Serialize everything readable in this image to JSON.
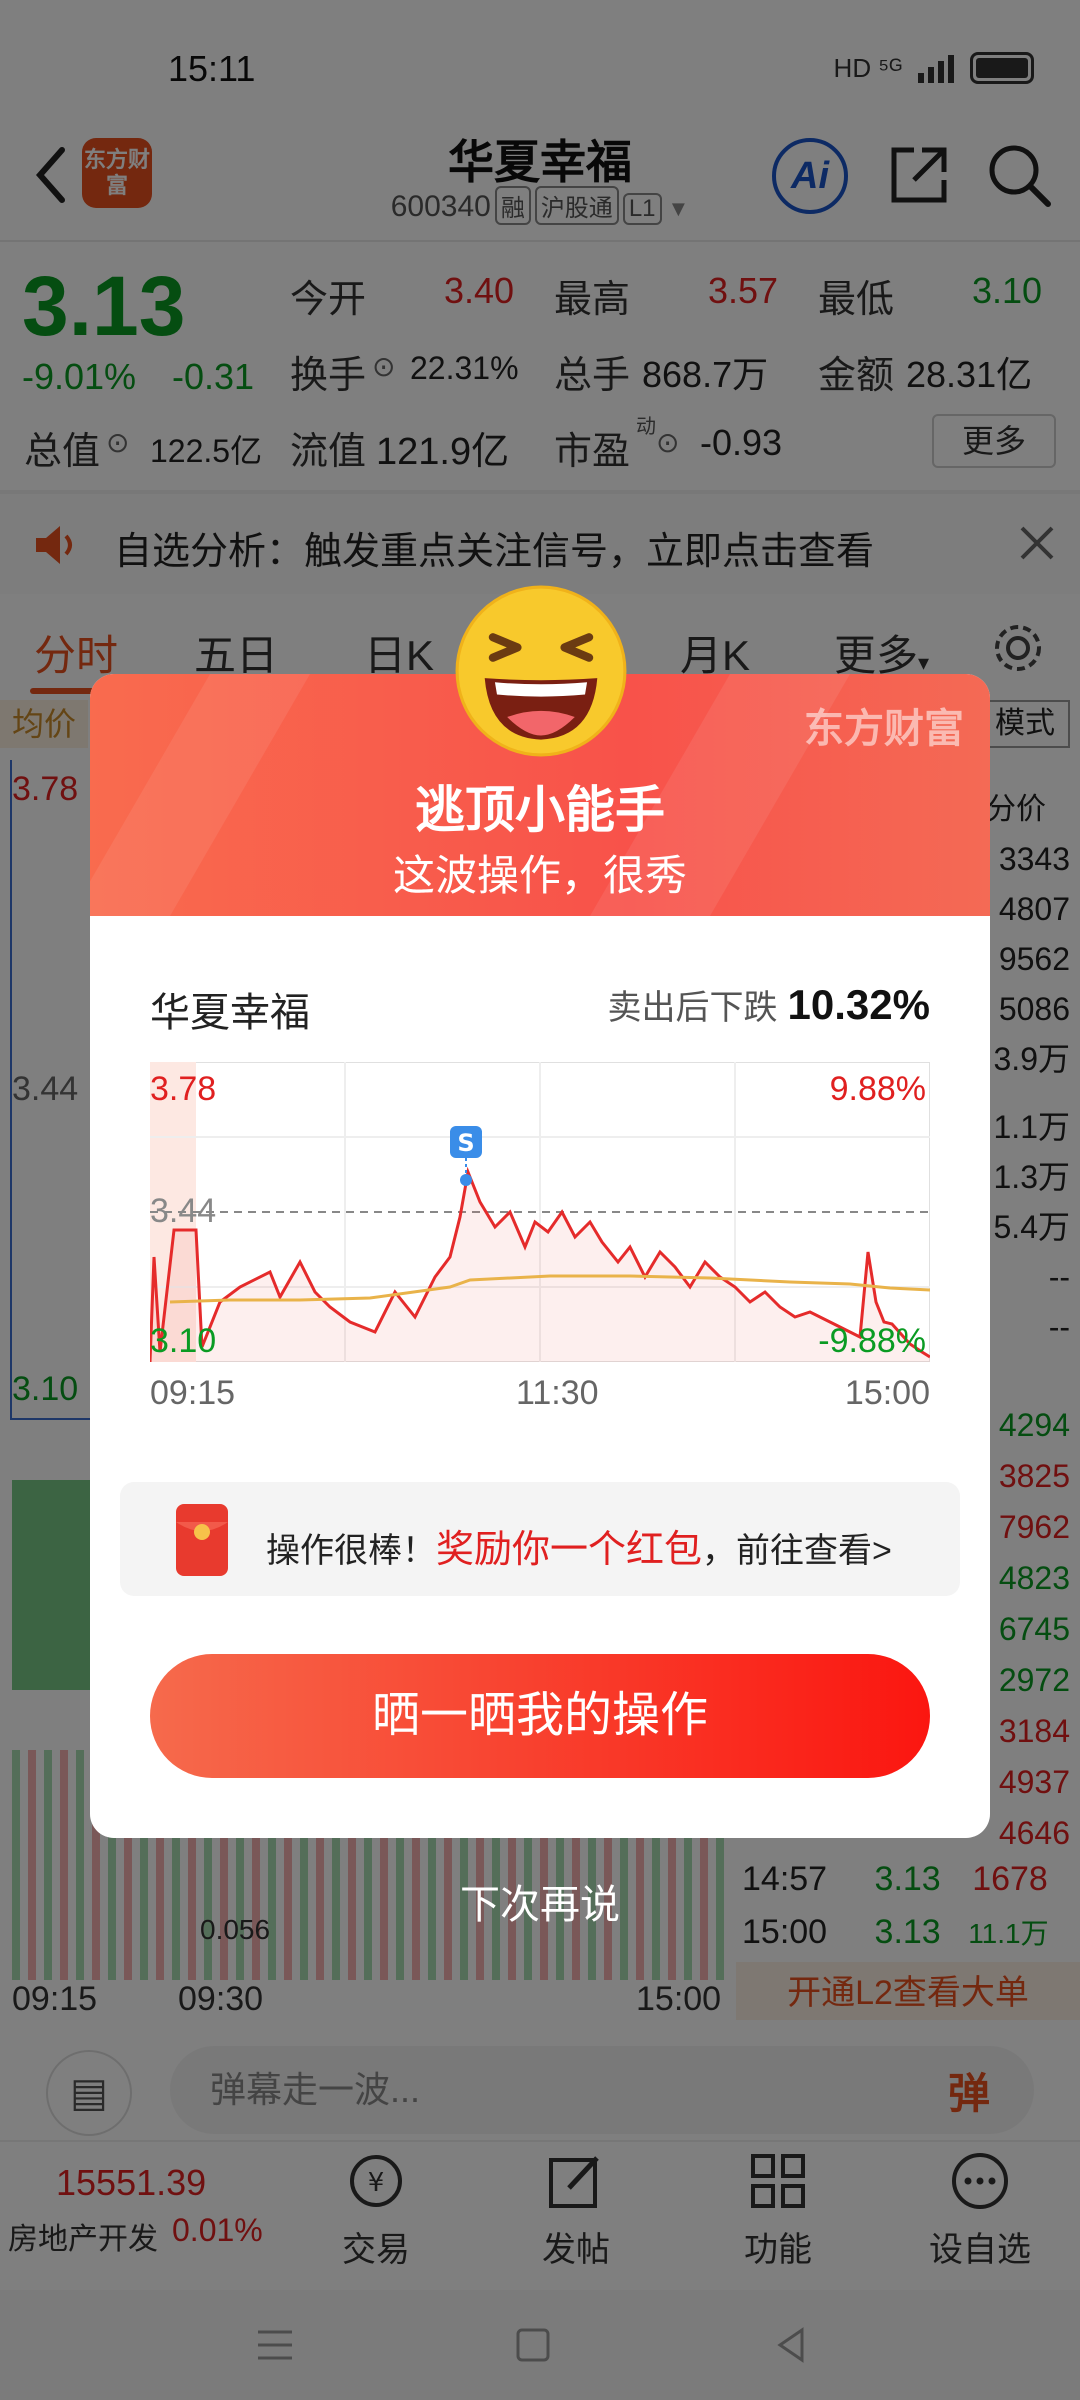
{
  "status_bar": {
    "time": "15:11",
    "network": "HD ⁵ᴳ"
  },
  "header": {
    "logo_text": "东方财富",
    "stock_name": "华夏幸福",
    "stock_code": "600340",
    "tags": [
      "融",
      "沪股通",
      "L1"
    ],
    "ai_label": "Ai"
  },
  "quote": {
    "price": "3.13",
    "change_pct": "-9.01%",
    "change": "-0.31",
    "open_label": "今开",
    "open": "3.40",
    "high_label": "最高",
    "high": "3.57",
    "low_label": "最低",
    "low": "3.10",
    "turnover_label": "换手",
    "turnover": "22.31%",
    "volume_label": "总手",
    "volume": "868.7万",
    "amount_label": "金额",
    "amount": "28.31亿",
    "total_value_label": "总值",
    "total_value": "122.5亿",
    "float_value_label": "流值",
    "float_value": "121.9亿",
    "pe_label": "市盈",
    "pe_sup": "动",
    "pe": "-0.93",
    "more": "更多"
  },
  "notice": {
    "text": "自选分析：触发重点关注信号，立即点击查看"
  },
  "tabs": [
    "分时",
    "五日",
    "日K",
    "月K",
    "更多"
  ],
  "bg_chart": {
    "avg_label": "均价",
    "mode_label": "模式",
    "fenjia_label": "分价",
    "y_top": "3.78",
    "y_mid": "3.44",
    "y_bot": "3.10",
    "vol_label": "0.056",
    "time_start": "09:15",
    "time_mid": "09:30",
    "time_end": "15:00",
    "side_values": [
      "3343",
      "4807",
      "9562",
      "5086",
      "3.9万",
      "1.1万",
      "1.3万",
      "5.4万",
      "--",
      "--",
      "4294",
      "3825",
      "7962",
      "4823",
      "6745",
      "2972",
      "3184",
      "4937",
      "4646"
    ],
    "tick1_time": "14:57",
    "tick1_price": "3.13",
    "tick1_vol": "1678",
    "tick2_time": "15:00",
    "tick2_price": "3.13",
    "tick2_vol": "11.1万",
    "l2_promo": "开通L2查看大单"
  },
  "bottom": {
    "danmu_placeholder": "弹幕走一波...",
    "danmu_btn": "弹",
    "index_value": "15551.39",
    "index_name": "房地产开发",
    "index_pct": "0.01%",
    "nav": [
      "交易",
      "发帖",
      "功能",
      "设自选"
    ]
  },
  "modal": {
    "brand": "东方财富",
    "title": "逃顶小能手",
    "subtitle": "这波操作，很秀",
    "stock": "华夏幸福",
    "desc": "卖出后下跌",
    "desc_value": "10.32%",
    "chart_top_left": "3.78",
    "chart_top_right": "9.88%",
    "chart_mid": "3.44",
    "chart_bot_left": "3.10",
    "chart_bot_right": "-9.88%",
    "sell_marker": "S",
    "times": [
      "09:15",
      "11:30",
      "15:00"
    ],
    "reward_prefix": "操作很棒！",
    "reward_highlight": "奖励你一个红包",
    "reward_suffix": "，前往查看>",
    "share_btn": "晒一晒我的操作",
    "later": "下次再说"
  },
  "colors": {
    "brand": "#e8501f",
    "up": "#e02020",
    "down": "#0a9b23",
    "modal_red": "#f8524a"
  }
}
